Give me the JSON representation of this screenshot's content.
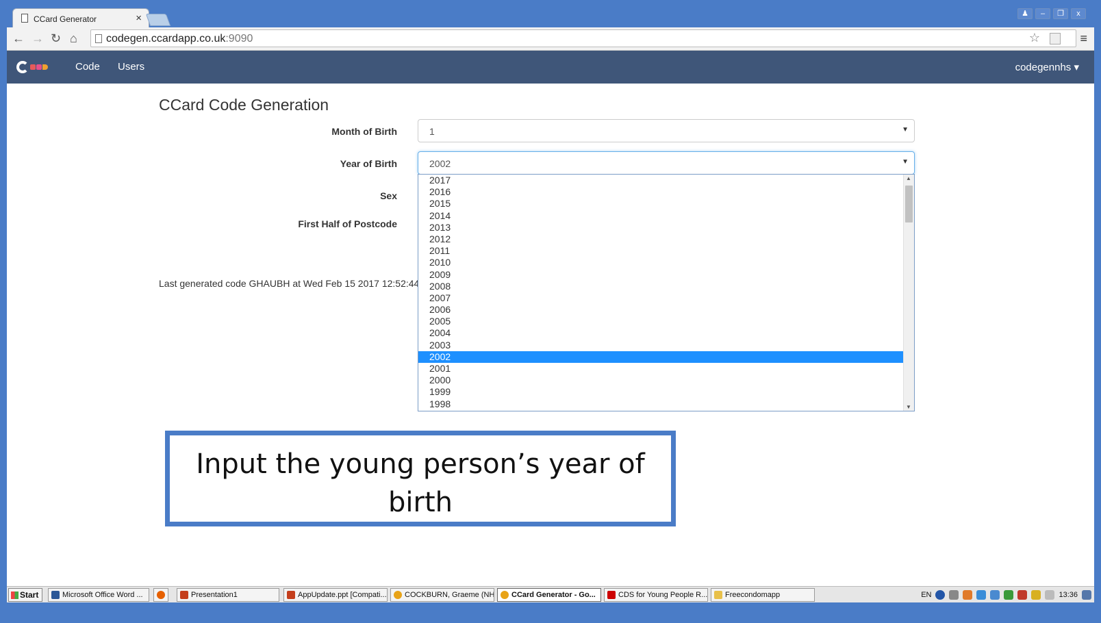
{
  "browser": {
    "tab_title": "CCard Generator",
    "tab_close": "×",
    "url_host": "codegen.ccardapp.co.uk",
    "url_port": ":9090",
    "window_buttons": [
      "♟",
      "–",
      "❐",
      "x"
    ]
  },
  "navbar": {
    "links": [
      "Code",
      "Users"
    ],
    "user": "codegennhs ▾"
  },
  "page": {
    "title": "CCard Code Generation",
    "month_label": "Month of Birth",
    "month_value": "1",
    "year_label": "Year of Birth",
    "year_value": "2002",
    "sex_label": "Sex",
    "postcode_label": "First Half of Postcode",
    "last_generated": "Last generated code GHAUBH at Wed Feb 15 2017 12:52:44",
    "year_options": [
      "2017",
      "2016",
      "2015",
      "2014",
      "2013",
      "2012",
      "2011",
      "2010",
      "2009",
      "2008",
      "2007",
      "2006",
      "2005",
      "2004",
      "2003",
      "2002",
      "2001",
      "2000",
      "1999",
      "1998"
    ],
    "selected_year": "2002"
  },
  "callout": {
    "line1": "Input the young person’s year of",
    "line2": "birth"
  },
  "taskbar": {
    "start": "Start",
    "items": [
      "Microsoft Office Word ...",
      "Presentation1",
      "AppUpdate.ppt [Compati...",
      "COCKBURN, Graeme (NH...",
      "CCard Generator - Go...",
      "CDS for Young People R...",
      "Freecondomapp"
    ],
    "lang": "EN",
    "clock": "13:36"
  },
  "colors": {
    "frame": "#4a7cc7",
    "navbar": "#3f5679",
    "selection": "#1e90ff"
  }
}
